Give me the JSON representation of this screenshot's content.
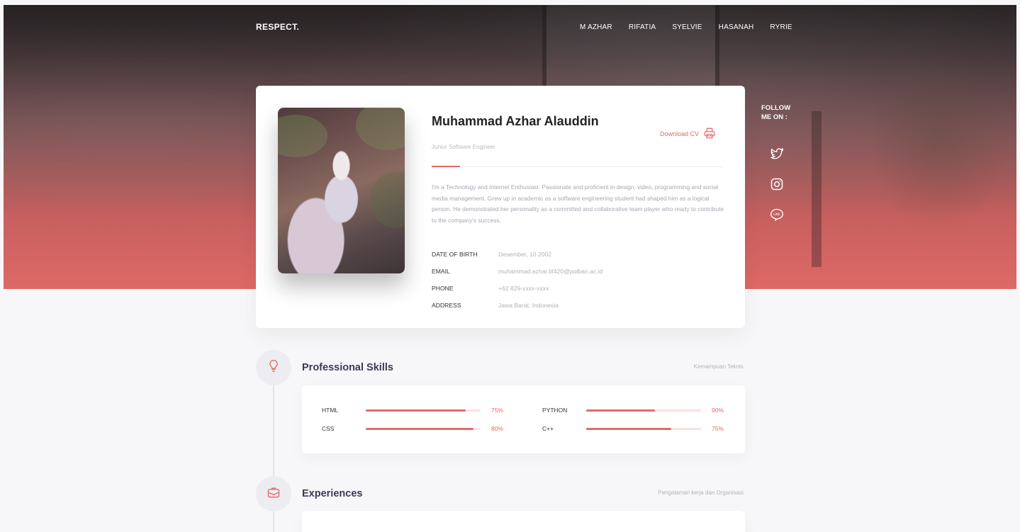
{
  "nav": {
    "brand": "RESPECT.",
    "links": [
      "M AZHAR",
      "RIFATIA",
      "SYELVIE",
      "HASANAH",
      "RYRIE"
    ]
  },
  "profile": {
    "name": "Muhammad Azhar Alauddin",
    "role": "Junior Software Engineer",
    "download_label": "Download CV",
    "bio": "I'm a Technology and Internet Enthusiast. Passionate and proficient in design, video, programming and social media management. Grew up in academic as a software engineering student had shaped him as a logical person. He demonstrated her personality as a committed and collaborative team player who ready to contribute to the company's success.",
    "info": [
      {
        "label": "DATE OF BIRTH",
        "value": "Desember, 10 2002"
      },
      {
        "label": "EMAIL",
        "value": "muhammad.azhar.tif420@polban.ac.id"
      },
      {
        "label": "PHONE",
        "value": "+62 829-xxxx-xxxx"
      },
      {
        "label": "ADDRESS",
        "value": "Jawa Barat, Indonesia"
      }
    ]
  },
  "follow": {
    "label": "FOLLOW ME ON :",
    "icons": [
      "twitter-icon",
      "instagram-icon",
      "line-icon"
    ]
  },
  "skills": {
    "title": "Professional Skills",
    "subtitle": "Kemampuan Teknis.",
    "items": [
      {
        "name": "HTML",
        "percent_label": "75%",
        "level": 0.87
      },
      {
        "name": "CSS",
        "percent_label": "80%",
        "level": 0.94
      },
      {
        "name": "PYTHON",
        "percent_label": "90%",
        "level": 0.6
      },
      {
        "name": "C++",
        "percent_label": "75%",
        "level": 0.74
      }
    ]
  },
  "experiences": {
    "title": "Experiences",
    "subtitle": "Pengalaman kerja dan Organisasi."
  },
  "colors": {
    "accent": "#e36a6c",
    "hero_top": "#262223",
    "hero_bottom": "#de6966"
  }
}
